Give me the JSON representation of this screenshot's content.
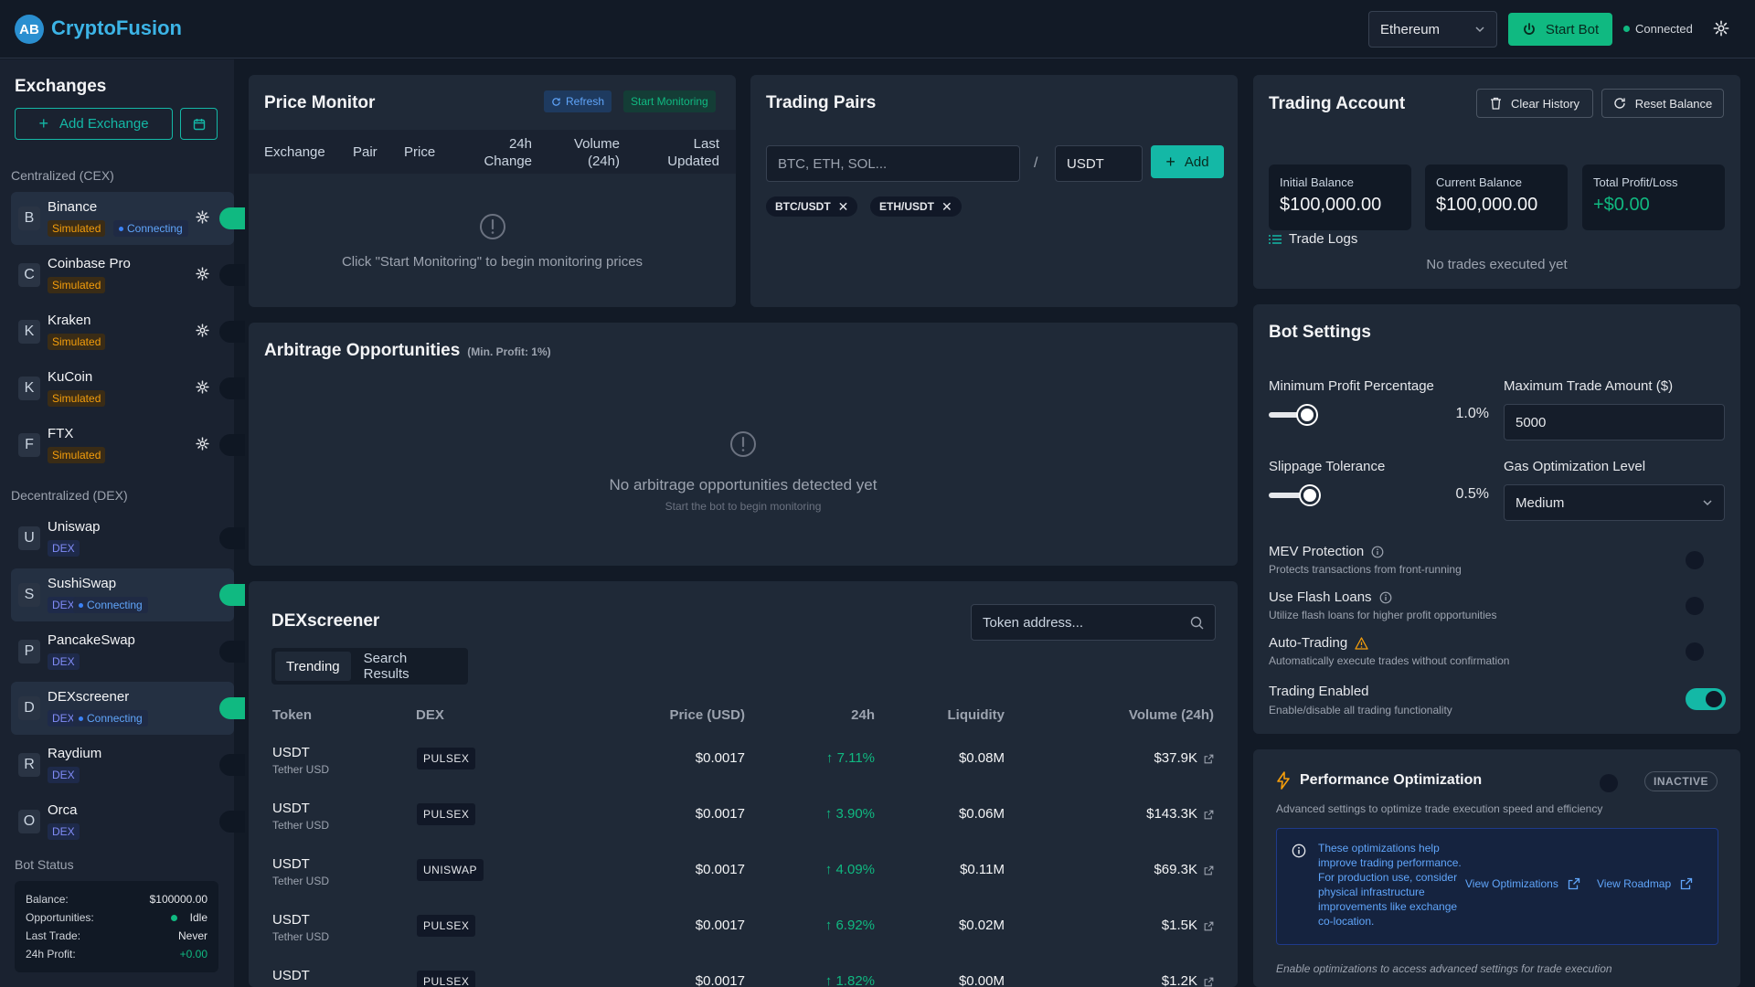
{
  "header": {
    "logo_initials": "AB",
    "app_title": "CryptoFusion",
    "network": "Ethereum",
    "start_bot_label": "Start Bot",
    "connection_status": "Connected"
  },
  "sidebar": {
    "title": "Exchanges",
    "add_exchange_label": "Add Exchange",
    "cex_label": "Centralized (CEX)",
    "dex_label": "Decentralized (DEX)",
    "cex": [
      {
        "letter": "B",
        "name": "Binance",
        "badge": "Simulated",
        "status": "Connecting"
      },
      {
        "letter": "C",
        "name": "Coinbase Pro",
        "badge": "Simulated"
      },
      {
        "letter": "K",
        "name": "Kraken",
        "badge": "Simulated"
      },
      {
        "letter": "K",
        "name": "KuCoin",
        "badge": "Simulated"
      },
      {
        "letter": "F",
        "name": "FTX",
        "badge": "Simulated"
      }
    ],
    "dex": [
      {
        "letter": "U",
        "name": "Uniswap",
        "badge": "DEX"
      },
      {
        "letter": "S",
        "name": "SushiSwap",
        "badge": "DEX",
        "status": "Connecting"
      },
      {
        "letter": "P",
        "name": "PancakeSwap",
        "badge": "DEX"
      },
      {
        "letter": "D",
        "name": "DEXscreener",
        "badge": "DEX",
        "status": "Connecting"
      },
      {
        "letter": "R",
        "name": "Raydium",
        "badge": "DEX"
      },
      {
        "letter": "O",
        "name": "Orca",
        "badge": "DEX"
      }
    ],
    "bot_status": {
      "title": "Bot Status",
      "rows": [
        {
          "label": "Balance:",
          "value": "$100000.00"
        },
        {
          "label": "Opportunities:",
          "value": "Idle"
        },
        {
          "label": "Last Trade:",
          "value": "Never"
        },
        {
          "label": "24h Profit:",
          "value": "+0.00"
        }
      ]
    }
  },
  "price_monitor": {
    "title": "Price Monitor",
    "refresh_label": "Refresh",
    "start_label": "Start Monitoring",
    "columns": [
      "Exchange",
      "Pair",
      "Price",
      "24h\nChange",
      "Volume\n(24h)",
      "Last\nUpdated"
    ],
    "empty_text": "Click \"Start Monitoring\" to begin monitoring prices"
  },
  "trading_pairs": {
    "title": "Trading Pairs",
    "base_placeholder": "BTC, ETH, SOL...",
    "separator": "/",
    "quote_value": "USDT",
    "add_label": "Add",
    "pairs": [
      "BTC/USDT",
      "ETH/USDT"
    ]
  },
  "account": {
    "title": "Trading Account",
    "clear_label": "Clear History",
    "reset_label": "Reset Balance",
    "stats": [
      {
        "label": "Initial Balance",
        "value": "$100,000.00"
      },
      {
        "label": "Current Balance",
        "value": "$100,000.00"
      },
      {
        "label": "Total Profit/Loss",
        "value": "+$0.00"
      }
    ],
    "logs_label": "Trade Logs",
    "logs_empty": "No trades executed yet"
  },
  "arbitrage": {
    "title": "Arbitrage Opportunities",
    "subtitle": "(Min. Profit: 1%)",
    "empty_title": "No arbitrage opportunities detected yet",
    "empty_sub": "Start the bot to begin monitoring"
  },
  "bot_settings": {
    "title": "Bot Settings",
    "min_profit_label": "Minimum Profit Percentage",
    "min_profit_value": "1.0%",
    "min_profit_fraction": 0.1,
    "max_trade_label": "Maximum Trade Amount ($)",
    "max_trade_value": "5000",
    "slippage_label": "Slippage Tolerance",
    "slippage_value": "0.5%",
    "slippage_fraction": 0.1,
    "gas_label": "Gas Optimization Level",
    "gas_value": "Medium",
    "toggles": [
      {
        "label": "MEV Protection",
        "desc": "Protects transactions from front-running",
        "on": false
      },
      {
        "label": "Use Flash Loans",
        "desc": "Utilize flash loans for higher profit opportunities",
        "on": false
      },
      {
        "label": "Auto-Trading",
        "desc": "Automatically execute trades without confirmation",
        "on": false
      },
      {
        "label": "Trading Enabled",
        "desc": "Enable/disable all trading functionality",
        "on": true
      }
    ]
  },
  "performance": {
    "title": "Performance Optimization",
    "status_badge": "INACTIVE",
    "desc": "Advanced settings to optimize trade execution speed and efficiency",
    "info_text": "These optimizations help improve trading performance. For production use, consider physical infrastructure improvements like exchange co-location.",
    "view_opt_label": "View Optimizations",
    "view_roadmap_label": "View Roadmap",
    "footer": "Enable optimizations to access advanced settings for trade execution"
  },
  "dexscreener": {
    "title": "DEXscreener",
    "search_placeholder": "Token address...",
    "tabs": [
      "Trending",
      "Search Results"
    ],
    "columns": [
      "Token",
      "DEX",
      "Price (USD)",
      "24h",
      "Liquidity",
      "Volume (24h)"
    ],
    "rows": [
      {
        "symbol": "USDT",
        "name": "Tether USD",
        "dex": "PULSEX",
        "price": "$0.0017",
        "change": "↑ 7.11%",
        "liquidity": "$0.08M",
        "volume": "$37.9K"
      },
      {
        "symbol": "USDT",
        "name": "Tether USD",
        "dex": "PULSEX",
        "price": "$0.0017",
        "change": "↑ 3.90%",
        "liquidity": "$0.06M",
        "volume": "$143.3K"
      },
      {
        "symbol": "USDT",
        "name": "Tether USD",
        "dex": "UNISWAP",
        "price": "$0.0017",
        "change": "↑ 4.09%",
        "liquidity": "$0.11M",
        "volume": "$69.3K"
      },
      {
        "symbol": "USDT",
        "name": "Tether USD",
        "dex": "PULSEX",
        "price": "$0.0017",
        "change": "↑ 6.92%",
        "liquidity": "$0.02M",
        "volume": "$1.5K"
      },
      {
        "symbol": "USDT",
        "name": "",
        "dex": "PULSEX",
        "price": "$0.0017",
        "change": "↑ 1.82%",
        "liquidity": "$0.00M",
        "volume": "$1.2K"
      }
    ]
  },
  "colors": {
    "accent": "#14b8a6",
    "primary_button": "#10b981",
    "warning": "#f59e0b",
    "info": "#60a5fa",
    "background": "#121a26",
    "card": "#1f2937"
  }
}
